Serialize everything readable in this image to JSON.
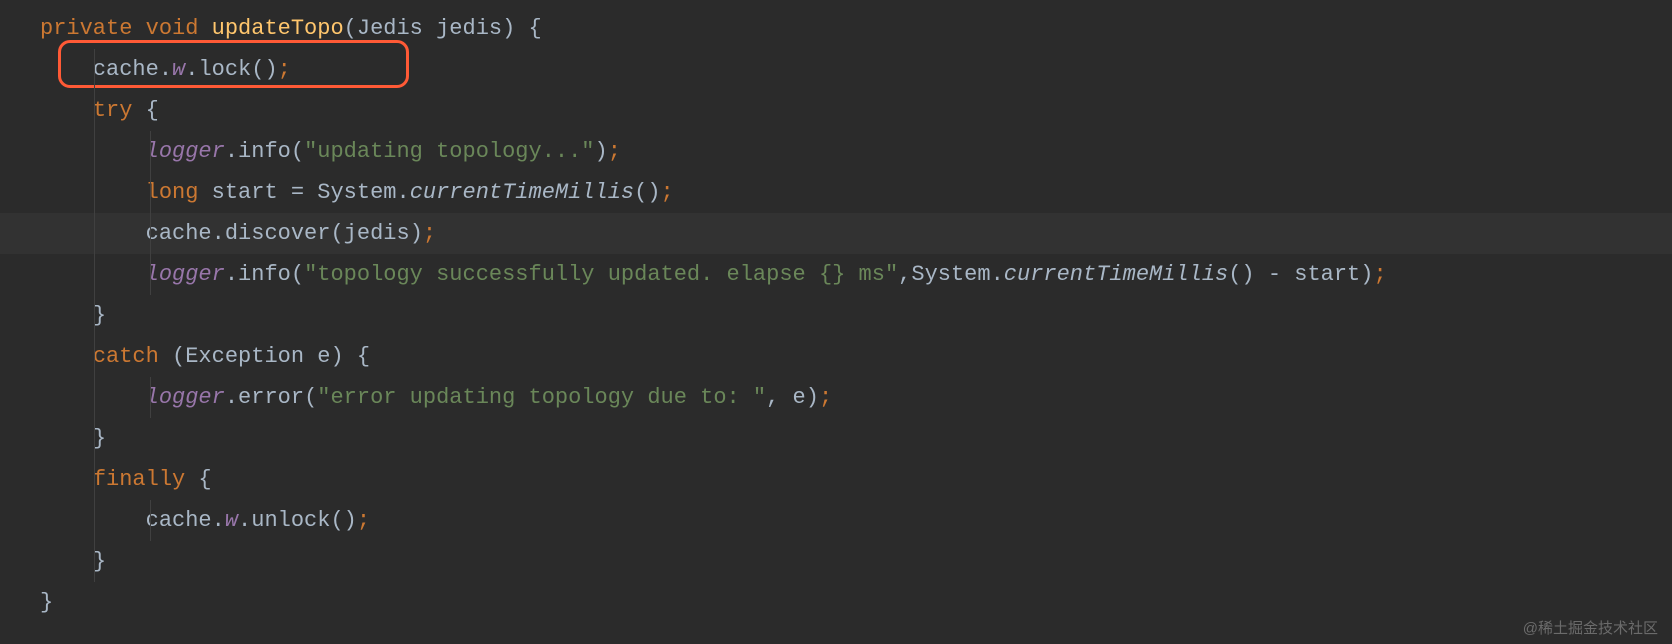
{
  "code": {
    "l1": {
      "kw1": "private",
      "kw2": "void",
      "fn": "updateTopo",
      "p1": "(",
      "ty": "Jedis",
      "sp": " ",
      "arg": "jedis",
      "p2": ") {"
    },
    "l2": {
      "a": "cache",
      "d1": ".",
      "b": "w",
      "d2": ".",
      "c": "lock",
      "p": "()",
      "s": ";"
    },
    "l3": {
      "kw": "try",
      "b": " {"
    },
    "l4": {
      "a": "logger",
      "d": ".",
      "m": "info",
      "p1": "(",
      "str": "\"updating topology...\"",
      "p2": ")",
      "s": ";"
    },
    "l5": {
      "kw": "long",
      "sp": " ",
      "v": "start",
      "eq": " = ",
      "cls": "System",
      "d": ".",
      "m": "currentTimeMillis",
      "p": "()",
      "s": ";"
    },
    "l6": {
      "a": "cache",
      "d": ".",
      "m": "discover",
      "p1": "(",
      "arg": "jedis",
      "p2": ")",
      "s": ";"
    },
    "l7": {
      "a": "logger",
      "d": ".",
      "m": "info",
      "p1": "(",
      "str": "\"topology successfully updated. elapse {} ms\"",
      "c1": ",",
      "cls": "System",
      "d2": ".",
      "m2": "currentTimeMillis",
      "p2": "()",
      "minus": " - ",
      "v": "start",
      "p3": ")",
      "s": ";"
    },
    "l8": {
      "b": "}"
    },
    "l9": {
      "kw": "catch",
      "p1": " (",
      "ty": "Exception",
      "sp": " ",
      "v": "e",
      "p2": ") {"
    },
    "l10": {
      "a": "logger",
      "d": ".",
      "m": "error",
      "p1": "(",
      "str": "\"error updating topology due to: \"",
      "c1": ", ",
      "v": "e",
      "p2": ")",
      "s": ";"
    },
    "l11": {
      "b": "}"
    },
    "l12": {
      "kw": "finally",
      "b": " {"
    },
    "l13": {
      "a": "cache",
      "d1": ".",
      "b": "w",
      "d2": ".",
      "c": "unlock",
      "p": "()",
      "s": ";"
    },
    "l14": {
      "b": "}"
    },
    "l15": {
      "b": "}"
    }
  },
  "watermark": "@稀土掘金技术社区"
}
